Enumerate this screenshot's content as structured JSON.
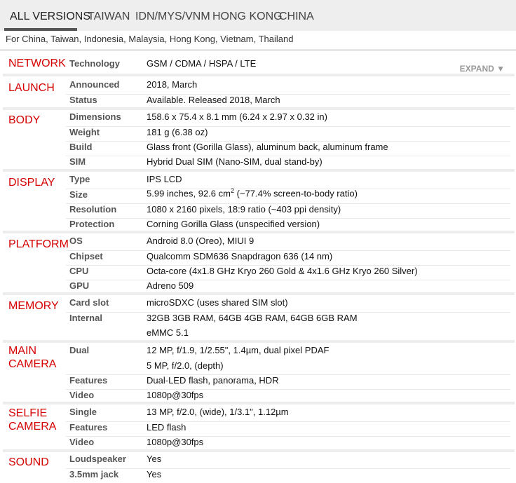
{
  "tabs": [
    {
      "label": "ALL VERSIONS"
    },
    {
      "label": "TAIWAN"
    },
    {
      "label": "IDN/MYS/VNM"
    },
    {
      "label": "HONG KONG"
    },
    {
      "label": "CHINA"
    }
  ],
  "region_note": "For China, Taiwan, Indonesia, Malaysia, Hong Kong, Vietnam, Thailand",
  "expand_label": "EXPAND ▼",
  "sections": [
    {
      "title": "NETWORK",
      "rows": [
        {
          "label": "Technology",
          "value": "GSM / CDMA / HSPA / LTE"
        }
      ]
    },
    {
      "title": "LAUNCH",
      "rows": [
        {
          "label": "Announced",
          "value": "2018, March"
        },
        {
          "label": "Status",
          "value": "Available. Released 2018, March"
        }
      ]
    },
    {
      "title": "BODY",
      "rows": [
        {
          "label": "Dimensions",
          "value": "158.6 x 75.4 x 8.1 mm (6.24 x 2.97 x 0.32 in)"
        },
        {
          "label": "Weight",
          "value": "181 g (6.38 oz)"
        },
        {
          "label": "Build",
          "value": "Glass front (Gorilla Glass), aluminum back, aluminum frame"
        },
        {
          "label": "SIM",
          "value": "Hybrid Dual SIM (Nano-SIM, dual stand-by)"
        }
      ]
    },
    {
      "title": "DISPLAY",
      "rows": [
        {
          "label": "Type",
          "value": "IPS LCD"
        },
        {
          "label": "Size",
          "value_pre": "5.99 inches, 92.6 cm",
          "value_sup": "2",
          "value_post": " (~77.4% screen-to-body ratio)"
        },
        {
          "label": "Resolution",
          "value": "1080 x 2160 pixels, 18:9 ratio (~403 ppi density)"
        },
        {
          "label": "Protection",
          "value": "Corning Gorilla Glass (unspecified version)"
        }
      ]
    },
    {
      "title": "PLATFORM",
      "rows": [
        {
          "label": "OS",
          "value": "Android 8.0 (Oreo), MIUI 9"
        },
        {
          "label": "Chipset",
          "value": "Qualcomm SDM636 Snapdragon 636 (14 nm)"
        },
        {
          "label": "CPU",
          "value": "Octa-core (4x1.8 GHz Kryo 260 Gold & 4x1.6 GHz Kryo 260 Silver)"
        },
        {
          "label": "GPU",
          "value": "Adreno 509"
        }
      ]
    },
    {
      "title": "MEMORY",
      "rows": [
        {
          "label": "Card slot",
          "value": "microSDXC (uses shared SIM slot)"
        },
        {
          "label": "Internal",
          "value": "32GB 3GB RAM, 64GB 4GB RAM, 64GB 6GB RAM"
        },
        {
          "label": "",
          "value": "eMMC 5.1"
        }
      ]
    },
    {
      "title_lines": [
        "MAIN",
        "CAMERA"
      ],
      "rows": [
        {
          "label": "Dual",
          "value": "12 MP, f/1.9, 1/2.55\", 1.4µm, dual pixel PDAF"
        },
        {
          "label": "",
          "value": "5 MP, f/2.0, (depth)"
        },
        {
          "label": "Features",
          "value": "Dual-LED flash, panorama, HDR"
        },
        {
          "label": "Video",
          "value": "1080p@30fps"
        }
      ]
    },
    {
      "title_lines": [
        "SELFIE",
        "CAMERA"
      ],
      "rows": [
        {
          "label": "Single",
          "value": "13 MP, f/2.0, (wide), 1/3.1\", 1.12µm"
        },
        {
          "label": "Features",
          "value": "LED flash"
        },
        {
          "label": "Video",
          "value": "1080p@30fps"
        }
      ]
    },
    {
      "title": "SOUND",
      "rows": [
        {
          "label": "Loudspeaker",
          "value": "Yes"
        },
        {
          "label": "3.5mm jack",
          "value": "Yes"
        }
      ]
    }
  ]
}
